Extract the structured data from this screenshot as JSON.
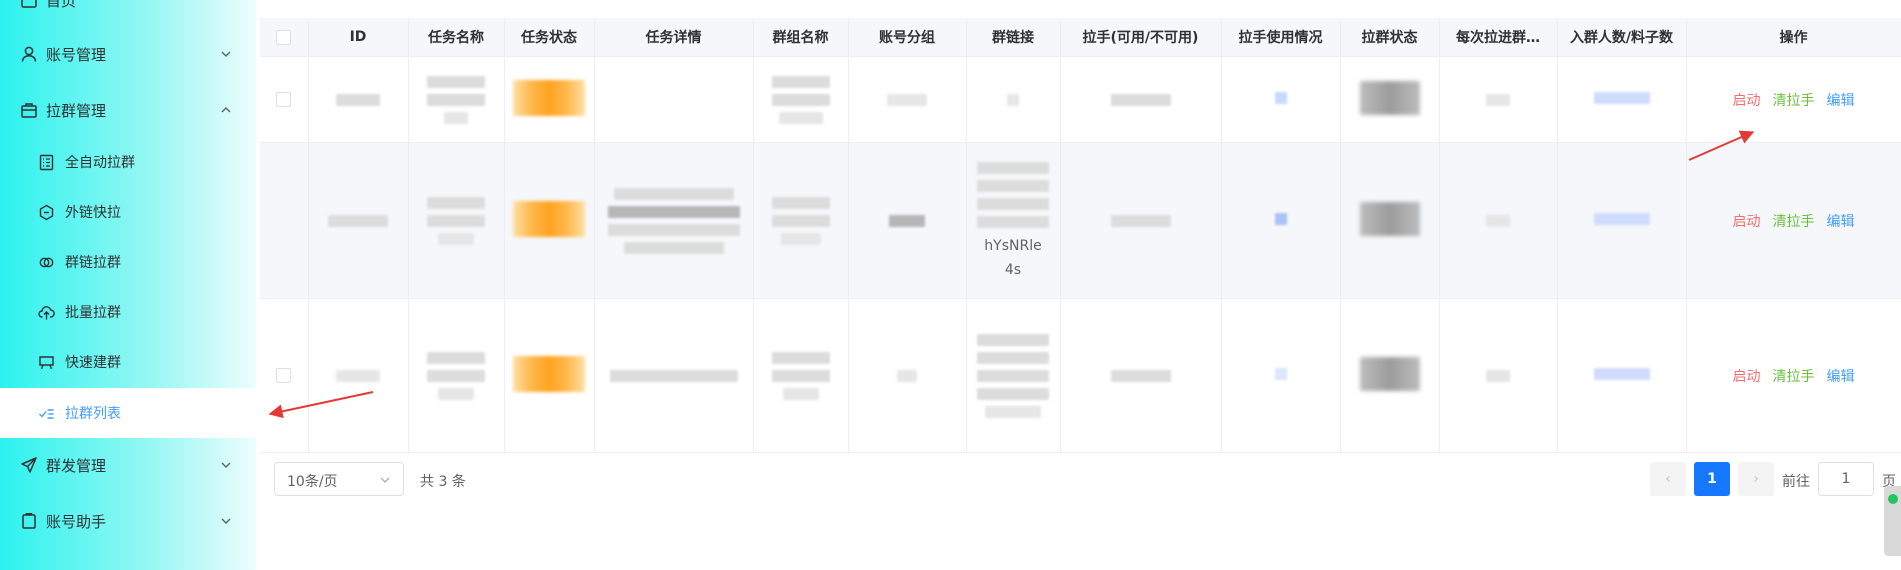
{
  "sidebar": {
    "items": [
      {
        "label": "首页",
        "icon": "home-icon"
      },
      {
        "label": "账号管理",
        "icon": "user-icon",
        "expanded": false
      },
      {
        "label": "拉群管理",
        "icon": "briefcase-icon",
        "expanded": true
      },
      {
        "label": "全自动拉群",
        "icon": "document-icon"
      },
      {
        "label": "外链快拉",
        "icon": "hexagon-link-icon"
      },
      {
        "label": "群链拉群",
        "icon": "link-chain-icon"
      },
      {
        "label": "批量拉群",
        "icon": "cloud-upload-icon"
      },
      {
        "label": "快速建群",
        "icon": "monitor-icon"
      },
      {
        "label": "拉群列表",
        "icon": "list-check-icon",
        "active": true
      },
      {
        "label": "群发管理",
        "icon": "send-icon",
        "expanded": false
      },
      {
        "label": "账号助手",
        "icon": "clipboard-icon",
        "expanded": false
      }
    ]
  },
  "table": {
    "columns": [
      "ID",
      "任务名称",
      "任务状态",
      "任务详情",
      "群组名称",
      "账号分组",
      "群链接",
      "拉手(可用/不可用)",
      "拉手使用情况",
      "拉群状态",
      "每次拉进群…",
      "入群人数/料子数",
      "操作"
    ],
    "rows": [
      {
        "group_link_text": []
      },
      {
        "group_link_text": [
          "hYsNRle",
          "4s"
        ]
      },
      {
        "group_link_text": []
      }
    ],
    "actions": {
      "start": "启动",
      "clear": "清拉手",
      "edit": "编辑"
    }
  },
  "pagination": {
    "page_size": "10条/页",
    "total": "共 3 条",
    "prev": "‹",
    "current_page": "1",
    "next": "›",
    "goto_label": "前往",
    "goto_value": "1",
    "page_suffix": "页"
  },
  "colors": {
    "accent": "#409eff",
    "start": "#f56c6c",
    "clear": "#67c23a",
    "edit": "#409eff",
    "annotation_arrow": "#e53935"
  }
}
